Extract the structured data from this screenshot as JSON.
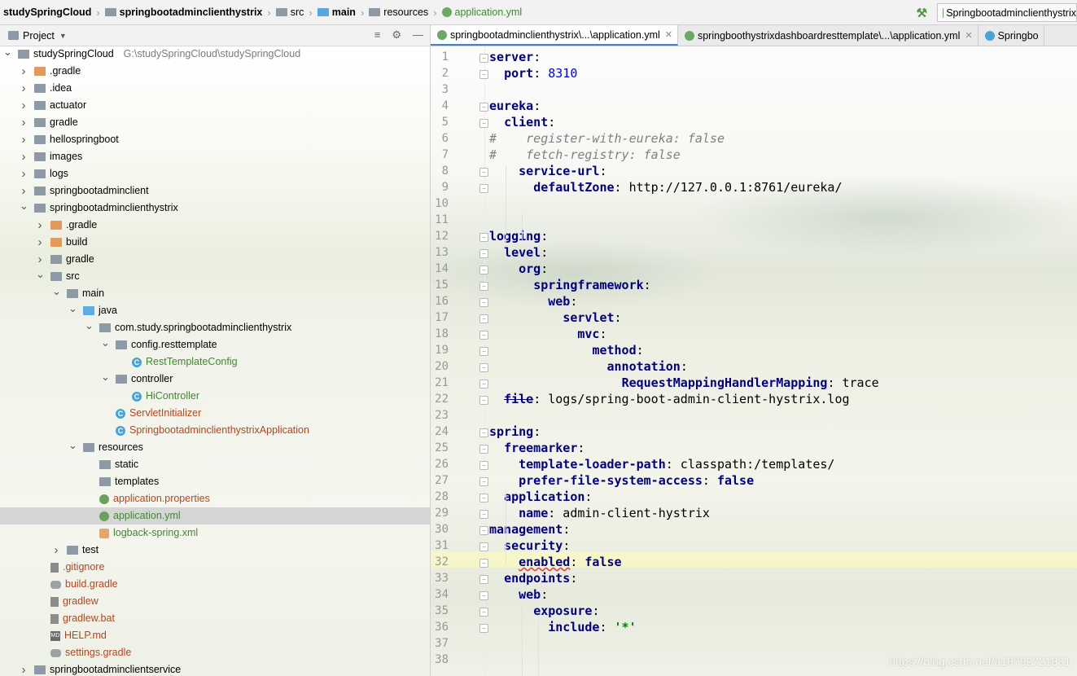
{
  "breadcrumbs": [
    "studySpringCloud",
    "springbootadminclienthystrix",
    "src",
    "main",
    "resources",
    "application.yml"
  ],
  "run_config": "Springbootadminclienthystrix",
  "project_panel": {
    "title": "Project",
    "tree": [
      {
        "label": "studySpringCloud",
        "path": "G:\\studySpringCloud\\studySpringCloud",
        "depth": 0,
        "expanded": true,
        "icon": "module-folder",
        "color": "dark"
      },
      {
        "label": ".gradle",
        "depth": 1,
        "expanded": false,
        "icon": "folder-orange",
        "color": "dark"
      },
      {
        "label": ".idea",
        "depth": 1,
        "expanded": false,
        "icon": "folder",
        "color": "dark"
      },
      {
        "label": "actuator",
        "depth": 1,
        "expanded": false,
        "icon": "module-folder",
        "color": "dark"
      },
      {
        "label": "gradle",
        "depth": 1,
        "expanded": false,
        "icon": "folder",
        "color": "dark"
      },
      {
        "label": "hellospringboot",
        "depth": 1,
        "expanded": false,
        "icon": "module-folder",
        "color": "dark"
      },
      {
        "label": "images",
        "depth": 1,
        "expanded": false,
        "icon": "folder",
        "color": "dark"
      },
      {
        "label": "logs",
        "depth": 1,
        "expanded": false,
        "icon": "folder",
        "color": "dark"
      },
      {
        "label": "springbootadminclient",
        "depth": 1,
        "expanded": false,
        "icon": "module-folder",
        "color": "dark"
      },
      {
        "label": "springbootadminclienthystrix",
        "depth": 1,
        "expanded": true,
        "icon": "module-folder",
        "color": "dark"
      },
      {
        "label": ".gradle",
        "depth": 2,
        "expanded": false,
        "icon": "folder-orange",
        "color": "dark"
      },
      {
        "label": "build",
        "depth": 2,
        "expanded": false,
        "icon": "folder-orange",
        "color": "dark"
      },
      {
        "label": "gradle",
        "depth": 2,
        "expanded": false,
        "icon": "folder",
        "color": "dark"
      },
      {
        "label": "src",
        "depth": 2,
        "expanded": true,
        "icon": "folder",
        "color": "dark"
      },
      {
        "label": "main",
        "depth": 3,
        "expanded": true,
        "icon": "folder",
        "color": "dark"
      },
      {
        "label": "java",
        "depth": 4,
        "expanded": true,
        "icon": "folder-blue",
        "color": "dark"
      },
      {
        "label": "com.study.springbootadminclienthystrix",
        "depth": 5,
        "expanded": true,
        "icon": "package",
        "color": "dark"
      },
      {
        "label": "config.resttemplate",
        "depth": 6,
        "expanded": true,
        "icon": "package",
        "color": "dark"
      },
      {
        "label": "RestTemplateConfig",
        "depth": 7,
        "expanded": null,
        "icon": "class",
        "color": "green"
      },
      {
        "label": "controller",
        "depth": 6,
        "expanded": true,
        "icon": "package",
        "color": "dark"
      },
      {
        "label": "HiController",
        "depth": 7,
        "expanded": null,
        "icon": "class",
        "color": "green"
      },
      {
        "label": "ServletInitializer",
        "depth": 6,
        "expanded": null,
        "icon": "class",
        "color": "red"
      },
      {
        "label": "SpringbootadminclienthystrixApplication",
        "depth": 6,
        "expanded": null,
        "icon": "class",
        "color": "red"
      },
      {
        "label": "resources",
        "depth": 4,
        "expanded": true,
        "icon": "folder",
        "color": "dark"
      },
      {
        "label": "static",
        "depth": 5,
        "expanded": null,
        "icon": "folder",
        "color": "dark"
      },
      {
        "label": "templates",
        "depth": 5,
        "expanded": null,
        "icon": "folder",
        "color": "dark"
      },
      {
        "label": "application.properties",
        "depth": 5,
        "expanded": null,
        "icon": "spring",
        "color": "red"
      },
      {
        "label": "application.yml",
        "depth": 5,
        "expanded": null,
        "icon": "spring",
        "color": "green",
        "selected": true
      },
      {
        "label": "logback-spring.xml",
        "depth": 5,
        "expanded": null,
        "icon": "xml",
        "color": "green"
      },
      {
        "label": "test",
        "depth": 3,
        "expanded": false,
        "icon": "folder",
        "color": "dark"
      },
      {
        "label": ".gitignore",
        "depth": 2,
        "expanded": null,
        "icon": "file",
        "color": "red"
      },
      {
        "label": "build.gradle",
        "depth": 2,
        "expanded": null,
        "icon": "gradle",
        "color": "red"
      },
      {
        "label": "gradlew",
        "depth": 2,
        "expanded": null,
        "icon": "file",
        "color": "red"
      },
      {
        "label": "gradlew.bat",
        "depth": 2,
        "expanded": null,
        "icon": "file",
        "color": "red"
      },
      {
        "label": "HELP.md",
        "depth": 2,
        "expanded": null,
        "icon": "md",
        "color": "red"
      },
      {
        "label": "settings.gradle",
        "depth": 2,
        "expanded": null,
        "icon": "gradle",
        "color": "red"
      },
      {
        "label": "springbootadminclientservice",
        "depth": 1,
        "expanded": false,
        "icon": "module-folder",
        "color": "dark"
      }
    ]
  },
  "editor": {
    "tabs": [
      {
        "label": "springbootadminclienthystrix\\...\\application.yml",
        "active": true,
        "closable": true
      },
      {
        "label": "springboothystrixdashboardresttemplate\\...\\application.yml",
        "active": false,
        "closable": true
      },
      {
        "label": "Springbo",
        "active": false,
        "closable": false
      }
    ],
    "current_line": 32,
    "lines": [
      [
        {
          "t": "k",
          "v": "server"
        },
        {
          "t": "v",
          "v": ":"
        }
      ],
      [
        {
          "t": "v",
          "v": "  "
        },
        {
          "t": "k",
          "v": "port"
        },
        {
          "t": "v",
          "v": ": "
        },
        {
          "t": "n",
          "v": "8310"
        }
      ],
      [],
      [
        {
          "t": "k",
          "v": "eureka"
        },
        {
          "t": "v",
          "v": ":"
        }
      ],
      [
        {
          "t": "v",
          "v": "  "
        },
        {
          "t": "k",
          "v": "client"
        },
        {
          "t": "v",
          "v": ":"
        }
      ],
      [
        {
          "t": "c",
          "v": "#    register-with-eureka: false"
        }
      ],
      [
        {
          "t": "c",
          "v": "#    fetch-registry: false"
        }
      ],
      [
        {
          "t": "v",
          "v": "    "
        },
        {
          "t": "k",
          "v": "service-url"
        },
        {
          "t": "v",
          "v": ":"
        }
      ],
      [
        {
          "t": "v",
          "v": "      "
        },
        {
          "t": "k",
          "v": "defaultZone"
        },
        {
          "t": "v",
          "v": ": http://127.0.0.1:8761/eureka/"
        }
      ],
      [],
      [],
      [
        {
          "t": "k",
          "v": "logging"
        },
        {
          "t": "v",
          "v": ":"
        }
      ],
      [
        {
          "t": "v",
          "v": "  "
        },
        {
          "t": "k",
          "v": "level"
        },
        {
          "t": "v",
          "v": ":"
        }
      ],
      [
        {
          "t": "v",
          "v": "    "
        },
        {
          "t": "k",
          "v": "org"
        },
        {
          "t": "v",
          "v": ":"
        }
      ],
      [
        {
          "t": "v",
          "v": "      "
        },
        {
          "t": "k",
          "v": "springframework"
        },
        {
          "t": "v",
          "v": ":"
        }
      ],
      [
        {
          "t": "v",
          "v": "        "
        },
        {
          "t": "k",
          "v": "web"
        },
        {
          "t": "v",
          "v": ":"
        }
      ],
      [
        {
          "t": "v",
          "v": "          "
        },
        {
          "t": "k",
          "v": "servlet"
        },
        {
          "t": "v",
          "v": ":"
        }
      ],
      [
        {
          "t": "v",
          "v": "            "
        },
        {
          "t": "k",
          "v": "mvc"
        },
        {
          "t": "v",
          "v": ":"
        }
      ],
      [
        {
          "t": "v",
          "v": "              "
        },
        {
          "t": "k",
          "v": "method"
        },
        {
          "t": "v",
          "v": ":"
        }
      ],
      [
        {
          "t": "v",
          "v": "                "
        },
        {
          "t": "k",
          "v": "annotation"
        },
        {
          "t": "v",
          "v": ":"
        }
      ],
      [
        {
          "t": "v",
          "v": "                  "
        },
        {
          "t": "k",
          "v": "RequestMappingHandlerMapping"
        },
        {
          "t": "v",
          "v": ": trace"
        }
      ],
      [
        {
          "t": "v",
          "v": "  "
        },
        {
          "t": "ks",
          "v": "file"
        },
        {
          "t": "v",
          "v": ": logs/spring-boot-admin-client-hystrix.log"
        }
      ],
      [],
      [
        {
          "t": "k",
          "v": "spring"
        },
        {
          "t": "v",
          "v": ":"
        }
      ],
      [
        {
          "t": "v",
          "v": "  "
        },
        {
          "t": "k",
          "v": "freemarker"
        },
        {
          "t": "v",
          "v": ":"
        }
      ],
      [
        {
          "t": "v",
          "v": "    "
        },
        {
          "t": "k",
          "v": "template-loader-path"
        },
        {
          "t": "v",
          "v": ": classpath:/templates/"
        }
      ],
      [
        {
          "t": "v",
          "v": "    "
        },
        {
          "t": "k",
          "v": "prefer-file-system-access"
        },
        {
          "t": "v",
          "v": ": "
        },
        {
          "t": "kw",
          "v": "false"
        }
      ],
      [
        {
          "t": "v",
          "v": "  "
        },
        {
          "t": "k",
          "v": "application"
        },
        {
          "t": "v",
          "v": ":"
        }
      ],
      [
        {
          "t": "v",
          "v": "    "
        },
        {
          "t": "k",
          "v": "name"
        },
        {
          "t": "v",
          "v": ": admin-client-hystrix"
        }
      ],
      [
        {
          "t": "k",
          "v": "management"
        },
        {
          "t": "v",
          "v": ":"
        }
      ],
      [
        {
          "t": "v",
          "v": "  "
        },
        {
          "t": "k",
          "v": "security"
        },
        {
          "t": "v",
          "v": ":"
        }
      ],
      [
        {
          "t": "v",
          "v": "    "
        },
        {
          "t": "kq",
          "v": "enabled"
        },
        {
          "t": "v",
          "v": ": "
        },
        {
          "t": "kw",
          "v": "false"
        }
      ],
      [
        {
          "t": "v",
          "v": "  "
        },
        {
          "t": "k",
          "v": "endpoints"
        },
        {
          "t": "v",
          "v": ":"
        }
      ],
      [
        {
          "t": "v",
          "v": "    "
        },
        {
          "t": "k",
          "v": "web"
        },
        {
          "t": "v",
          "v": ":"
        }
      ],
      [
        {
          "t": "v",
          "v": "      "
        },
        {
          "t": "k",
          "v": "exposure"
        },
        {
          "t": "v",
          "v": ":"
        }
      ],
      [
        {
          "t": "v",
          "v": "        "
        },
        {
          "t": "k",
          "v": "include"
        },
        {
          "t": "v",
          "v": ": "
        },
        {
          "t": "s",
          "v": "'*'"
        }
      ],
      [],
      []
    ]
  },
  "watermark": "https://blog.csdn.net/a18792721831"
}
